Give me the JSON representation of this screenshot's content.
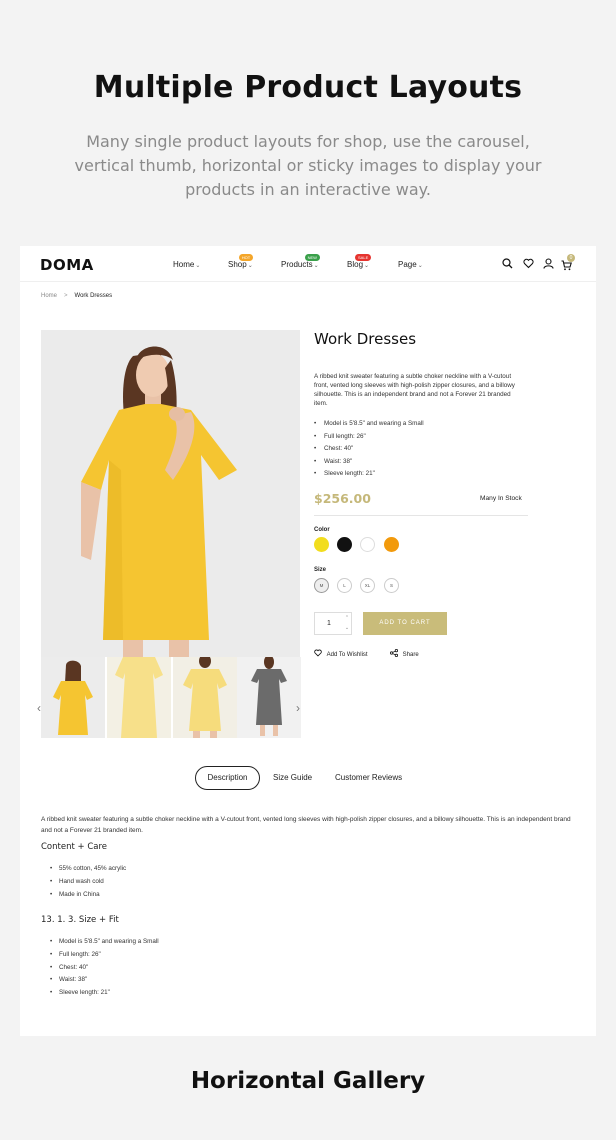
{
  "hero": {
    "title": "Multiple Product Layouts",
    "subtitle": "Many single product layouts for shop, use the carousel, vertical thumb, horizontal or sticky images to display your products in an interactive way."
  },
  "header": {
    "logo": "DOMA",
    "nav": [
      {
        "label": "Home",
        "badge": ""
      },
      {
        "label": "Shop",
        "badge": "HOT",
        "badge_color": "#f4a62a"
      },
      {
        "label": "Products",
        "badge": "NEW",
        "badge_color": "#3aa04a"
      },
      {
        "label": "Blog",
        "badge": "SALE",
        "badge_color": "#e6342f"
      },
      {
        "label": "Page",
        "badge": ""
      }
    ],
    "icons": [
      "search-icon",
      "heart-icon",
      "user-icon",
      "cart-icon"
    ],
    "cart_count": "0"
  },
  "breadcrumb": {
    "home": "Home",
    "separator": ">",
    "current": "Work Dresses"
  },
  "product": {
    "title": "Work Dresses",
    "description": "A ribbed knit sweater featuring a subtle choker neckline with a V-cutout front, vented long sleeves with high-polish zipper closures, and a billowy silhouette. This is an independent brand and not a Forever 21 branded item.",
    "specs": [
      "Model is 5'8.5\" and wearing a Small",
      "Full length: 26\"",
      "Chest: 40\"",
      "Waist: 38\"",
      "Sleeve length: 21\""
    ],
    "price": "$256.00",
    "stock": "Many In Stock",
    "accent_color": "#c5b87a",
    "color_label": "Color",
    "colors": [
      "#f2dd1e",
      "#111111",
      "#ffffff",
      "#f29a0c"
    ],
    "size_label": "Size",
    "sizes": [
      "M",
      "L",
      "XL",
      "S"
    ],
    "quantity": "1",
    "add_to_cart": "ADD TO CART",
    "wishlist": "Add To Wishlist",
    "share": "Share"
  },
  "tabs": [
    "Description",
    "Size Guide",
    "Customer Reviews"
  ],
  "details": {
    "paragraph": "A ribbed knit sweater featuring a subtle choker neckline with a V-cutout front, vented long sleeves with high-polish zipper closures, and a billowy silhouette. This is an independent brand and not a Forever 21 branded item.",
    "content_heading": "Content + Care",
    "content_items": [
      "55% cotton, 45% acrylic",
      "Hand wash cold",
      "Made in China"
    ],
    "size_heading": "13. 1. 3. Size + Fit",
    "size_items": [
      "Model is 5'8.5\" and wearing a Small",
      "Full length: 26\"",
      "Chest: 40\"",
      "Waist: 38\"",
      "Sleeve length: 21\""
    ]
  },
  "footer": {
    "title": "Horizontal Gallery"
  }
}
